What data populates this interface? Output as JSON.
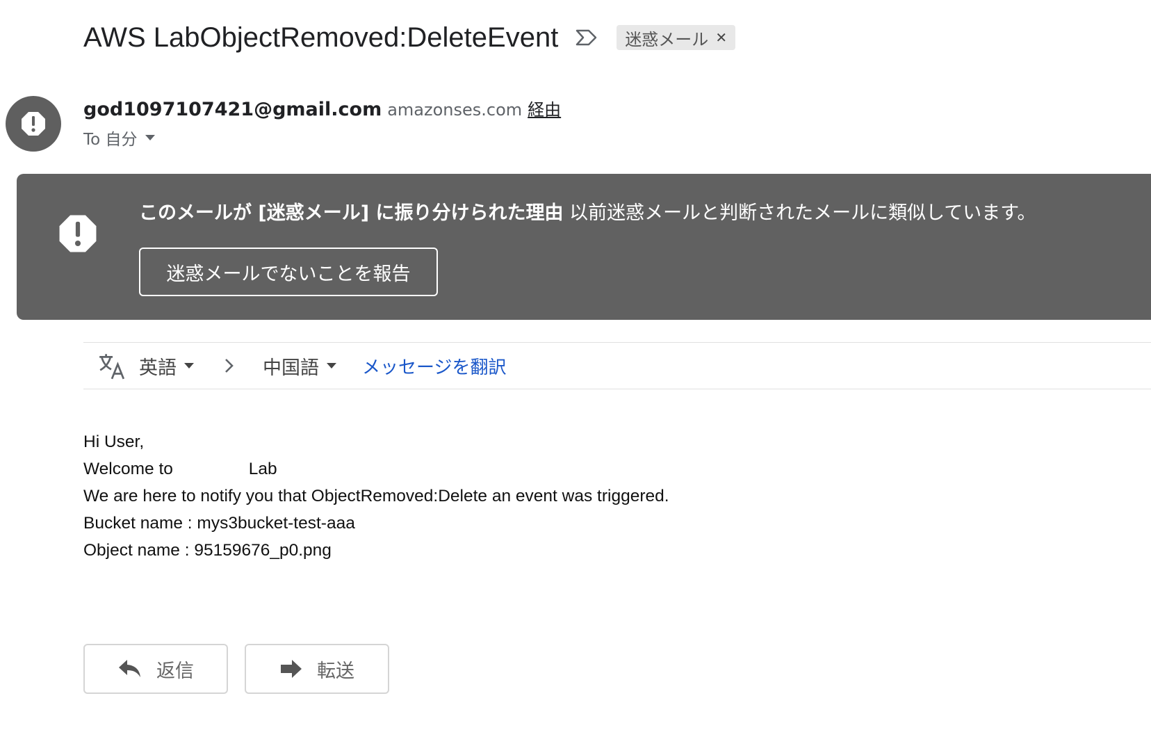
{
  "subject": {
    "title": "AWS LabObjectRemoved:DeleteEvent",
    "important_icon": "important-marker-icon",
    "label": "迷惑メール",
    "label_remove_icon": "close-icon"
  },
  "sender": {
    "avatar_icon": "alert-icon",
    "email": "god1097107421@gmail.com",
    "domain": "amazonses.com",
    "via": "経由",
    "to": "To 自分",
    "to_icon": "caret-down-icon"
  },
  "spam_banner": {
    "icon": "alert-icon",
    "reason_bold": "このメールが [迷惑メール] に振り分けられた理由",
    "reason_text": " 以前迷惑メールと判断されたメールに類似しています。",
    "report_button": "迷惑メールでないことを報告",
    "color": "#616161"
  },
  "translate": {
    "icon": "translate-icon",
    "source_lang": "英語",
    "target_lang": "中国語",
    "arrow_icon": "chevron-right-icon",
    "link": "メッセージを翻訳",
    "link_color": "#1a57c9"
  },
  "body": {
    "lines": [
      "Hi User,",
      "Welcome to                Lab",
      "We are here to notify you that ObjectRemoved:Delete an event was triggered.",
      "Bucket name : mys3bucket-test-aaa",
      "Object name : 95159676_p0.png"
    ]
  },
  "actions": {
    "reply": "返信",
    "reply_icon": "reply-icon",
    "forward": "転送",
    "forward_icon": "forward-icon"
  }
}
